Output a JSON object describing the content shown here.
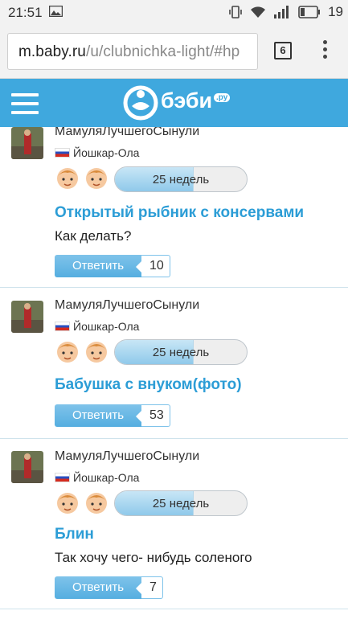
{
  "status_bar": {
    "time": "21:51",
    "battery_level": "19",
    "icons": [
      "image-icon",
      "vibrate-icon",
      "wifi-icon",
      "signal-icon",
      "battery-icon"
    ]
  },
  "browser": {
    "url_host": "m.baby.ru",
    "url_path": "/u/clubnichka-light/#hp",
    "tab_count": "6",
    "menu_icon": "more-vert-icon"
  },
  "site": {
    "logo_text": "бэби",
    "logo_suffix": ".ру",
    "brand_color": "#3fa8de",
    "menu_icon": "hamburger-icon"
  },
  "posts": [
    {
      "author": "МамуляЛучшегоСынули",
      "city": "Йошкар-Ола",
      "weeks": "25 недель",
      "pregnancy_progress": 0.6,
      "title": "Открытый рыбник с консервами",
      "body": "Как делать?",
      "reply_label": "Ответить",
      "reply_count": "10"
    },
    {
      "author": "МамуляЛучшегоСынули",
      "city": "Йошкар-Ола",
      "weeks": "25 недель",
      "pregnancy_progress": 0.6,
      "title": "Бабушка с внуком(фото)",
      "body": "",
      "reply_label": "Ответить",
      "reply_count": "53"
    },
    {
      "author": "МамуляЛучшегоСынули",
      "city": "Йошкар-Ола",
      "weeks": "25 недель",
      "pregnancy_progress": 0.6,
      "title": "Блин",
      "body": "Так хочу чего- нибудь соленого",
      "reply_label": "Ответить",
      "reply_count": "7"
    }
  ]
}
